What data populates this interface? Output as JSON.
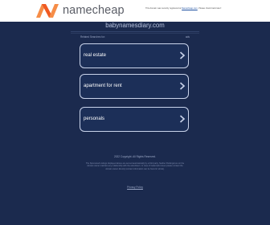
{
  "brand": {
    "name": "namecheap",
    "accent": "#f05a22",
    "accent_light": "#f68d47"
  },
  "top_notice": {
    "before": "This domain was recently registered at",
    "link": "Namecheap.com",
    "after": ". Please check back later!"
  },
  "domain": "babynamesdiary.com",
  "related": {
    "header": "Related Searches for:",
    "right": "ads",
    "items": [
      {
        "label": "real estate",
        "icon": "chevron-right-icon"
      },
      {
        "label": "apartment for rent",
        "icon": "chevron-right-icon"
      },
      {
        "label": "personals",
        "icon": "chevron-right-icon"
      }
    ]
  },
  "footer": {
    "copyright": "2022 Copyright. All Rights Reserved.",
    "disclaimer": "The Sponsored Listings displayed above are served automatically by a third party. Neither Parkingcrew nor the domain owner maintain any relationship with the advertisers. In case of trademark issues please contact the domain owner directly (contact information can be found in whois).",
    "privacy": "Privacy Policy"
  }
}
